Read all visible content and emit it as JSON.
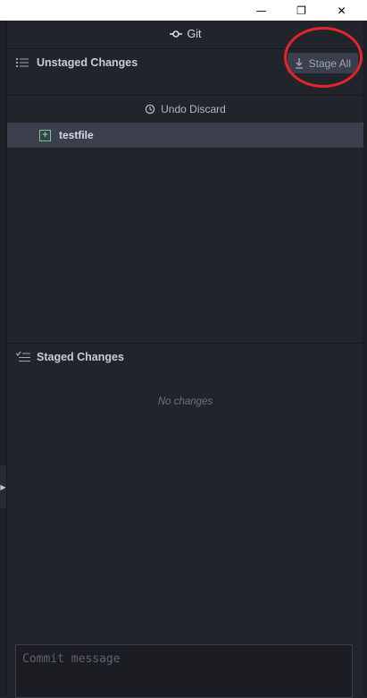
{
  "window_controls": {
    "minimize_glyph": "—",
    "maximize_glyph": "❐",
    "close_glyph": "✕"
  },
  "git_panel": {
    "title": "Git",
    "title_icon": "git-commit-icon",
    "unstaged": {
      "label": "Unstaged Changes",
      "icon": "list-icon",
      "stage_all_label": "Stage All",
      "stage_all_icon": "download-icon",
      "undo_discard_label": "Undo Discard",
      "undo_icon": "history-icon",
      "files": [
        {
          "name": "testfile",
          "status": "added"
        }
      ]
    },
    "staged": {
      "label": "Staged Changes",
      "icon": "checklist-icon",
      "empty_text": "No changes"
    },
    "commit": {
      "placeholder": "Commit message"
    }
  },
  "colors": {
    "panel_bg": "#21252b",
    "selected_row": "#3a3f4b",
    "added_green": "#73c990",
    "annotation_red": "#e3242b"
  }
}
